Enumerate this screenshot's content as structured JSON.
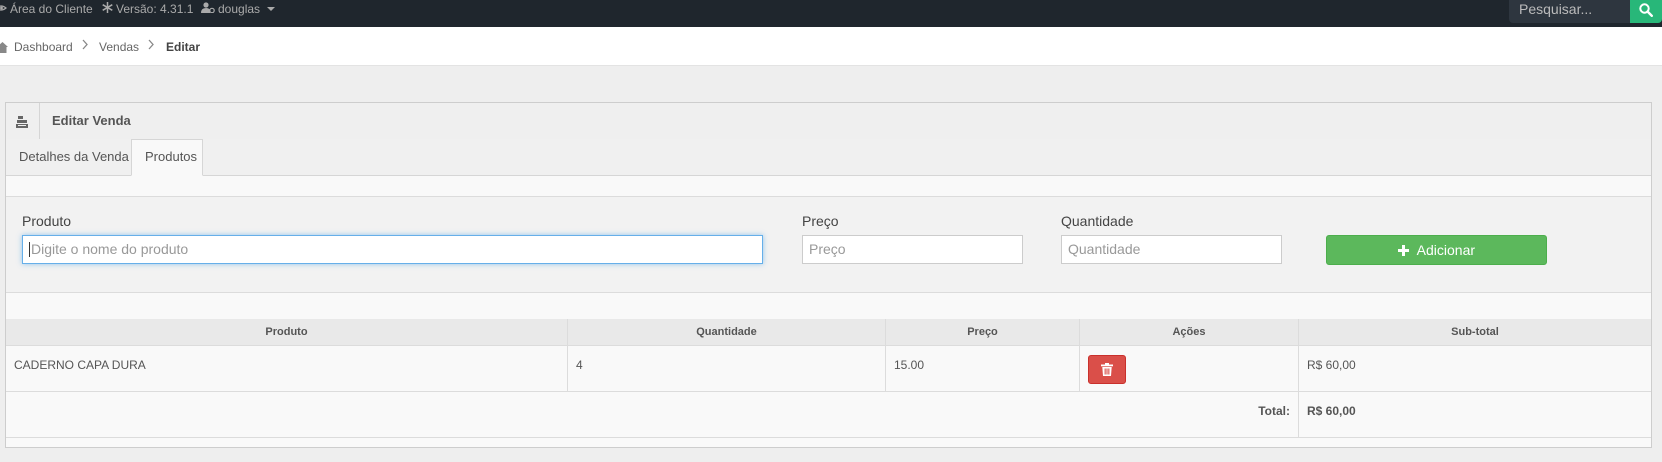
{
  "topbar": {
    "customer_area": "Área do Cliente",
    "version": "Versão: 4.31.1",
    "user": "douglas",
    "search_placeholder": "Pesquisar..."
  },
  "breadcrumb": {
    "items": [
      "Dashboard",
      "Vendas",
      "Editar"
    ]
  },
  "widget": {
    "title": "Editar Venda",
    "tabs": [
      {
        "label": "Detalhes da Venda",
        "active": false
      },
      {
        "label": "Produtos",
        "active": true
      }
    ]
  },
  "form": {
    "produto_label": "Produto",
    "produto_placeholder": "Digite o nome do produto",
    "preco_label": "Preço",
    "preco_placeholder": "Preço",
    "quantidade_label": "Quantidade",
    "quantidade_placeholder": "Quantidade",
    "add_button": "Adicionar"
  },
  "table": {
    "headers": [
      "Produto",
      "Quantidade",
      "Preço",
      "Ações",
      "Sub-total"
    ],
    "rows": [
      {
        "produto": "CADERNO CAPA DURA",
        "quantidade": "4",
        "preco": "15.00",
        "subtotal": "R$ 60,00"
      }
    ],
    "total_label": "Total:",
    "total_value": "R$ 60,00"
  },
  "colors": {
    "topbar": "#1f262d",
    "search_button": "#28b779",
    "add_button": "#5cb85c",
    "delete_button": "#da4f49"
  },
  "icons": [
    "eye-icon",
    "asterisk-icon",
    "user-cog-icon",
    "caret-down-icon",
    "search-icon",
    "home-icon",
    "chevron-right-icon",
    "cash-register-icon",
    "plus-icon",
    "trash-icon"
  ]
}
